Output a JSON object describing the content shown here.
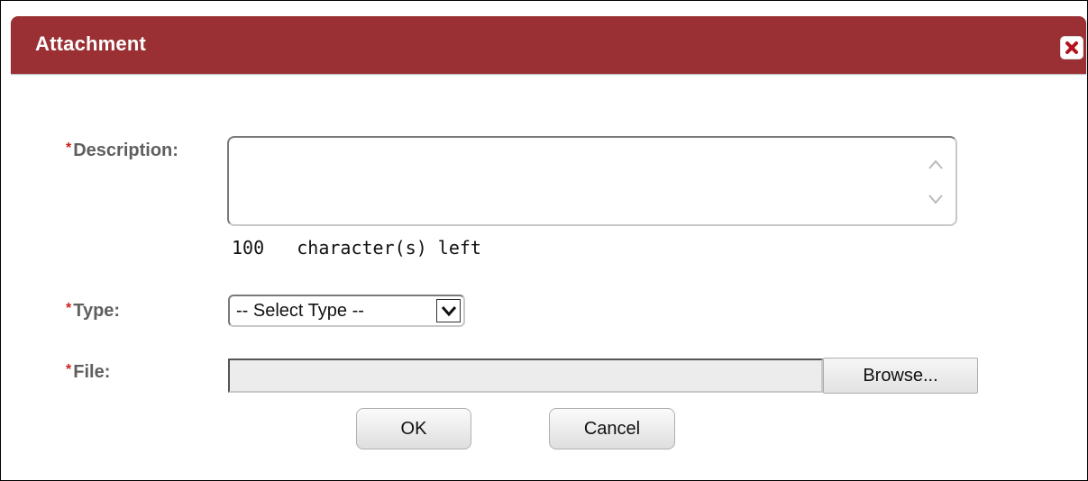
{
  "dialog": {
    "title": "Attachment",
    "close_icon": "close-icon",
    "titlebar_color": "#9a3033"
  },
  "form": {
    "required_marker": "*",
    "description": {
      "label": "Description:",
      "value": "",
      "chars_left_count": "100",
      "chars_left_text": "character(s) left"
    },
    "type": {
      "label": "Type:",
      "selected": "-- Select Type --"
    },
    "file": {
      "label": "File:",
      "value": "",
      "browse_label": "Browse..."
    }
  },
  "actions": {
    "ok_label": "OK",
    "cancel_label": "Cancel"
  }
}
